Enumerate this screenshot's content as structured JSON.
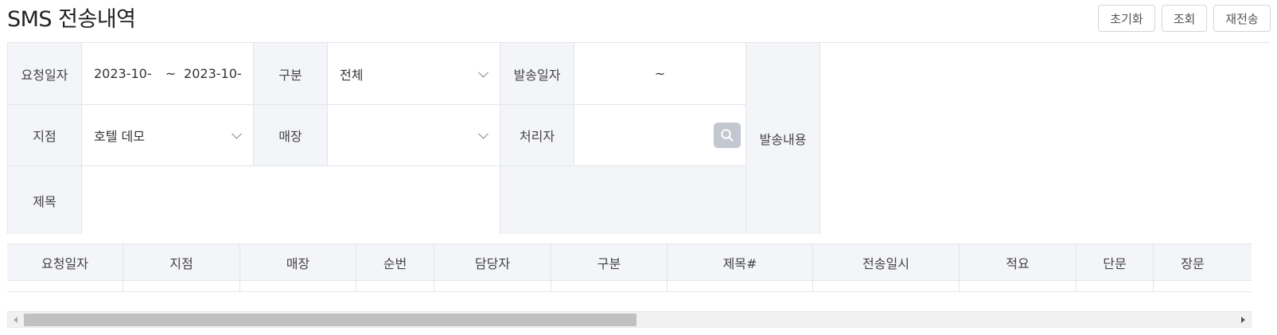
{
  "page": {
    "title": "SMS 전송내역"
  },
  "buttons": {
    "reset": "초기화",
    "search": "조회",
    "resend": "재전송"
  },
  "filters": {
    "request_date": {
      "label": "요청일자",
      "from": "2023-10-",
      "sep": "~",
      "to": "2023-10-"
    },
    "category": {
      "label": "구분",
      "value": "전체"
    },
    "send_date": {
      "label": "발송일자",
      "sep": "~"
    },
    "branch": {
      "label": "지점",
      "value": "호텔 데모"
    },
    "store": {
      "label": "매장",
      "value": ""
    },
    "handler": {
      "label": "처리자",
      "value": ""
    },
    "content": {
      "label": "발송내용"
    },
    "subject": {
      "label": "제목",
      "value": ""
    }
  },
  "grid": {
    "columns": [
      "요청일자",
      "지점",
      "매장",
      "순번",
      "담당자",
      "구분",
      "제목#",
      "전송일시",
      "적요",
      "단문",
      "장문"
    ]
  },
  "colors": {
    "label_bg": "#f4f5f8",
    "border": "#e2e5ea",
    "search_button": "#c3c7cf"
  }
}
